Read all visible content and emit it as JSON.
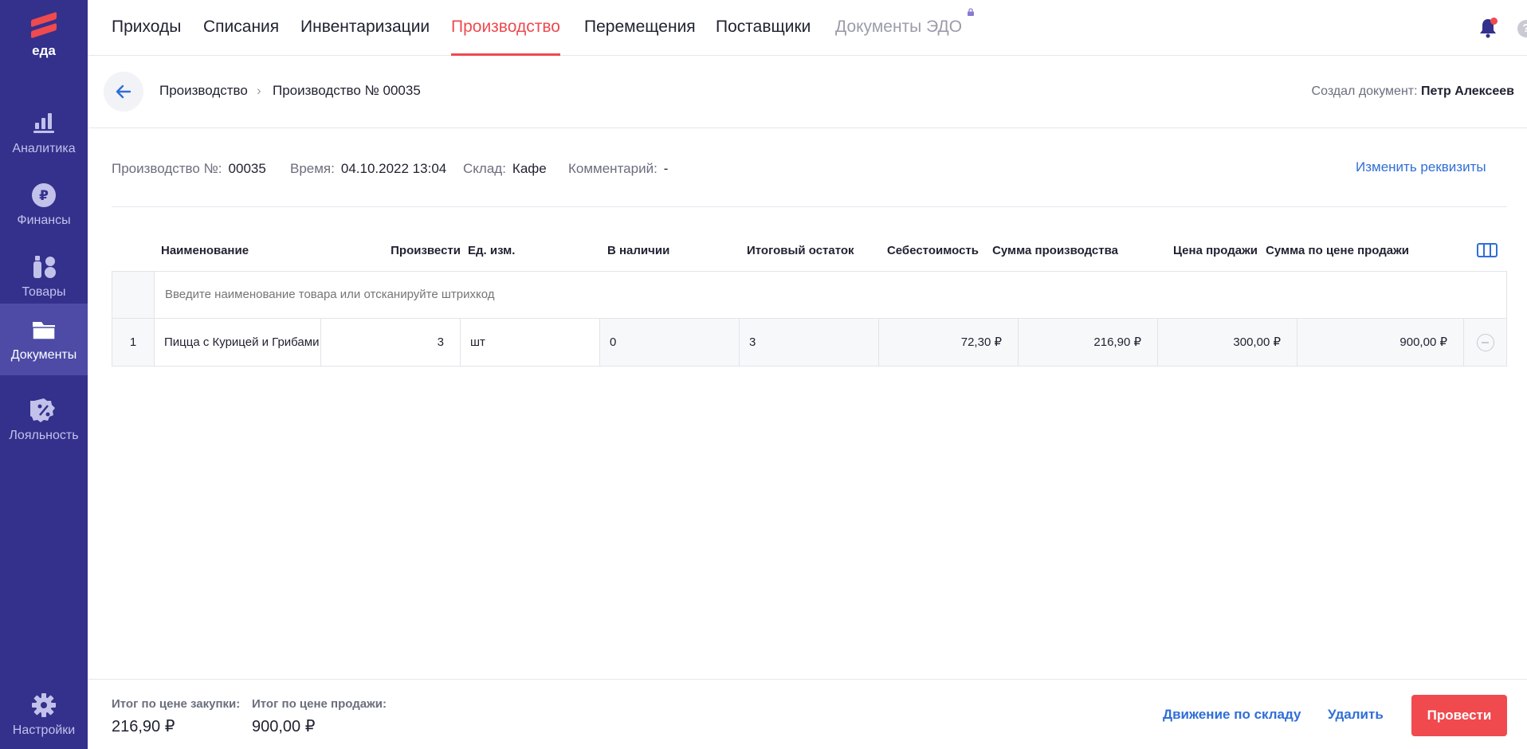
{
  "brand": {
    "name": "еда",
    "accent": "#ee4a4f",
    "sidebar_bg": "#33318c"
  },
  "sidebar": {
    "items": [
      {
        "label": "Аналитика",
        "icon": "bar-chart-icon"
      },
      {
        "label": "Финансы",
        "icon": "ruble-coin-icon"
      },
      {
        "label": "Товары",
        "icon": "products-icon"
      },
      {
        "label": "Документы",
        "icon": "folder-icon",
        "active": true
      },
      {
        "label": "Лояльность",
        "icon": "percent-badge-icon"
      }
    ],
    "settings": {
      "label": "Настройки",
      "icon": "gear-icon"
    }
  },
  "topnav": {
    "tabs": [
      {
        "label": "Приходы"
      },
      {
        "label": "Списания"
      },
      {
        "label": "Инвентаризации"
      },
      {
        "label": "Производство",
        "active": true
      },
      {
        "label": "Перемещения"
      },
      {
        "label": "Поставщики"
      },
      {
        "label": "Документы ЭДО",
        "disabled": true,
        "icon": "lock-icon"
      }
    ]
  },
  "header": {
    "breadcrumb": [
      "Производство",
      "Производство № 00035"
    ],
    "creator_label": "Создал документ:",
    "creator_name": "Петр Алексеев"
  },
  "requisites": {
    "number_label": "Производство №:",
    "number": "00035",
    "time_label": "Время:",
    "time": "04.10.2022 13:04",
    "warehouse_label": "Склад:",
    "warehouse": "Кафе",
    "comment_label": "Комментарий:",
    "comment": "-",
    "edit_label": "Изменить реквизиты"
  },
  "table": {
    "headers": [
      "Наименование",
      "Произвести",
      "Ед. изм.",
      "В наличии",
      "Итоговый остаток",
      "Себестоимость",
      "Сумма производства",
      "Цена продажи",
      "Сумма по цене продажи"
    ],
    "search_placeholder": "Введите наименование товара или отсканируйте штрихкод",
    "rows": [
      {
        "index": "1",
        "name": "Пицца с Курицей и Грибами",
        "qty": "3",
        "unit": "шт",
        "in_stock": "0",
        "final_stock": "3",
        "cost": "72,30 ₽",
        "production_sum": "216,90 ₽",
        "price": "300,00 ₽",
        "sale_sum": "900,00 ₽"
      }
    ]
  },
  "footer": {
    "purchase_total_label": "Итог по цене закупки:",
    "purchase_total": "216,90 ₽",
    "sale_total_label": "Итог по цене продажи:",
    "sale_total": "900,00 ₽",
    "movement_label": "Движение по складу",
    "delete_label": "Удалить",
    "submit_label": "Провести"
  }
}
